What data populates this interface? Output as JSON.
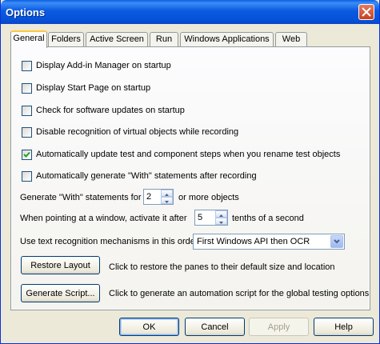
{
  "window": {
    "title": "Options"
  },
  "tabs": [
    {
      "label": "General",
      "active": true
    },
    {
      "label": "Folders"
    },
    {
      "label": "Active Screen"
    },
    {
      "label": "Run"
    },
    {
      "label": "Windows Applications"
    },
    {
      "label": "Web"
    }
  ],
  "checkboxes": [
    {
      "label": "Display Add-in Manager on startup",
      "checked": false
    },
    {
      "label": "Display Start Page on startup",
      "checked": false
    },
    {
      "label": "Check for software updates on startup",
      "checked": false
    },
    {
      "label": "Disable recognition of virtual objects while recording",
      "checked": false
    },
    {
      "label": "Automatically update test and component steps when you rename test objects",
      "checked": true
    },
    {
      "label": "Automatically generate \"With\" statements after recording",
      "checked": false
    }
  ],
  "with_statements": {
    "prefix": "Generate \"With\" statements for",
    "value": "2",
    "suffix": "or more objects"
  },
  "activate_window": {
    "prefix": "When pointing at a window, activate it after",
    "value": "5",
    "suffix": "tenths of a second"
  },
  "text_recognition": {
    "label": "Use text recognition mechanisms in this order:",
    "selected": "First Windows API then OCR"
  },
  "restore_layout": {
    "button": "Restore Layout",
    "description": "Click to restore the panes to their default size and location"
  },
  "generate_script": {
    "button": "Generate Script...",
    "description": "Click to generate an automation script for the global testing options"
  },
  "footer": {
    "ok": "OK",
    "cancel": "Cancel",
    "apply": "Apply",
    "help": "Help"
  }
}
